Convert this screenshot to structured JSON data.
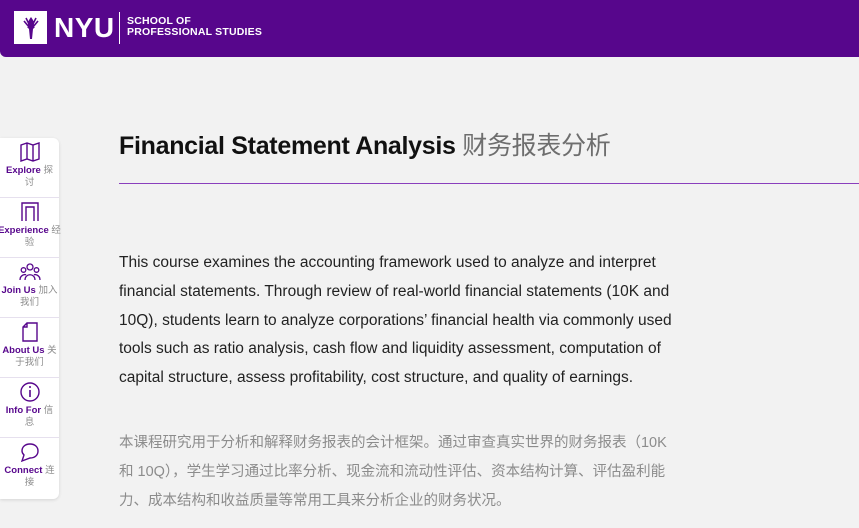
{
  "header": {
    "brand": "NYU",
    "school_line1": "SCHOOL OF",
    "school_line2": "PROFESSIONAL STUDIES",
    "color": "#57068c"
  },
  "sidebar": {
    "items": [
      {
        "label_en": "Explore",
        "label_zh_1": "探",
        "label_zh_2": "讨",
        "icon": "map-icon"
      },
      {
        "label_en": "Experience",
        "label_zh_1": "经",
        "label_zh_2": "验",
        "icon": "arch-icon"
      },
      {
        "label_en": "Join Us",
        "label_zh_1": "加入",
        "label_zh_2": "我们",
        "icon": "people-icon"
      },
      {
        "label_en": "About Us",
        "label_zh_1": "关",
        "label_zh_2": "于我们",
        "icon": "document-icon"
      },
      {
        "label_en": "Info For",
        "label_zh_1": "信",
        "label_zh_2": "息",
        "icon": "info-icon"
      },
      {
        "label_en": "Connect",
        "label_zh_1": "连",
        "label_zh_2": "接",
        "icon": "chat-icon"
      }
    ]
  },
  "main": {
    "title_en": "Financial Statement Analysis",
    "title_zh": "财务报表分析",
    "description_en": "This course examines the accounting framework used to analyze and interpret financial statements. Through review of real-world financial statements (10K and 10Q), students learn to analyze corporations’ financial health via commonly used tools such as ratio analysis, cash flow and liquidity assessment, computation of capital structure, assess profitability, cost structure, and quality of earnings.",
    "description_zh": "本课程研究用于分析和解释财务报表的会计框架。通过审查真实世界的财务报表（10K 和 10Q），学生学习通过比率分析、现金流和流动性评估、资本结构计算、评估盈利能力、成本结构和收益质量等常用工具来分析企业的财务状况。"
  }
}
